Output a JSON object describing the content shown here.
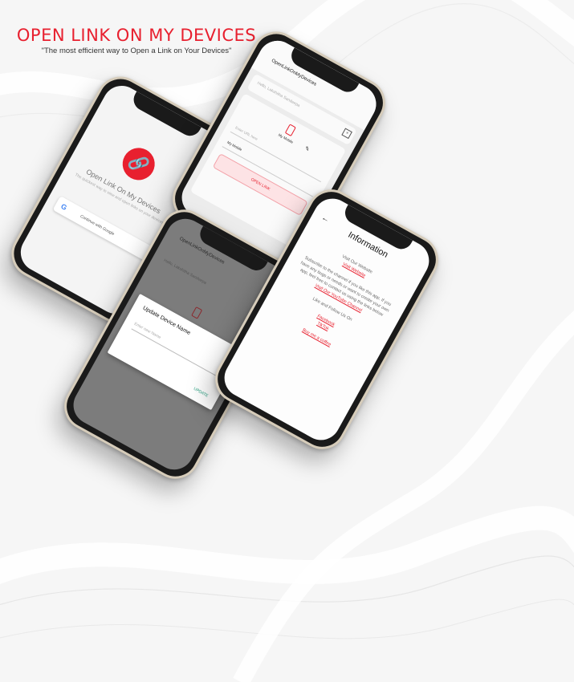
{
  "header": {
    "title": "OPEN LINK ON MY DEVICES",
    "tagline": "\"The most efficient way to Open a Link on Your Devices\""
  },
  "colors": {
    "accent": "#e8202f",
    "update_green": "#1a9a78",
    "frame_gold": "#d6ccba"
  },
  "login_screen": {
    "logo_icon": "link-icon",
    "app_name": "Open Link On My Devices",
    "subtitle": "The quickest way to view and open links on your devices",
    "google_button": "Continue with Google"
  },
  "main_screen": {
    "app_bar_title": "OpenLinkOnMyDevices",
    "greeting": "Hello, Lakshitha Sandeepa",
    "device_label": "My Mobile",
    "url_placeholder": "Enter URL here",
    "device_select": "My Mobile",
    "open_button": "OPEN LINK"
  },
  "dialog_screen": {
    "app_bar_title": "OpenLinkOnMyDevices",
    "greeting": "Hello, Lakshitha Sandeepa",
    "dialog_title": "Update Device Name",
    "input_placeholder": "Enter new Name",
    "update_button": "UPDATE"
  },
  "info_screen": {
    "title": "Information",
    "visit_text": "Visit Our Website",
    "website_link": "Visit Website",
    "subscribe_text": "Subscribe to the channel if you like this app. If you have any bugs or needs or want to create your own app, feel free to contact us using the links below",
    "youtube_link": "Visit Our YouTube Channel",
    "follow_text": "Like and Follow Us On",
    "facebook_link": "Facebook",
    "tiktok_link": "TikTok",
    "coffee_link": "Buy me a coffee"
  }
}
